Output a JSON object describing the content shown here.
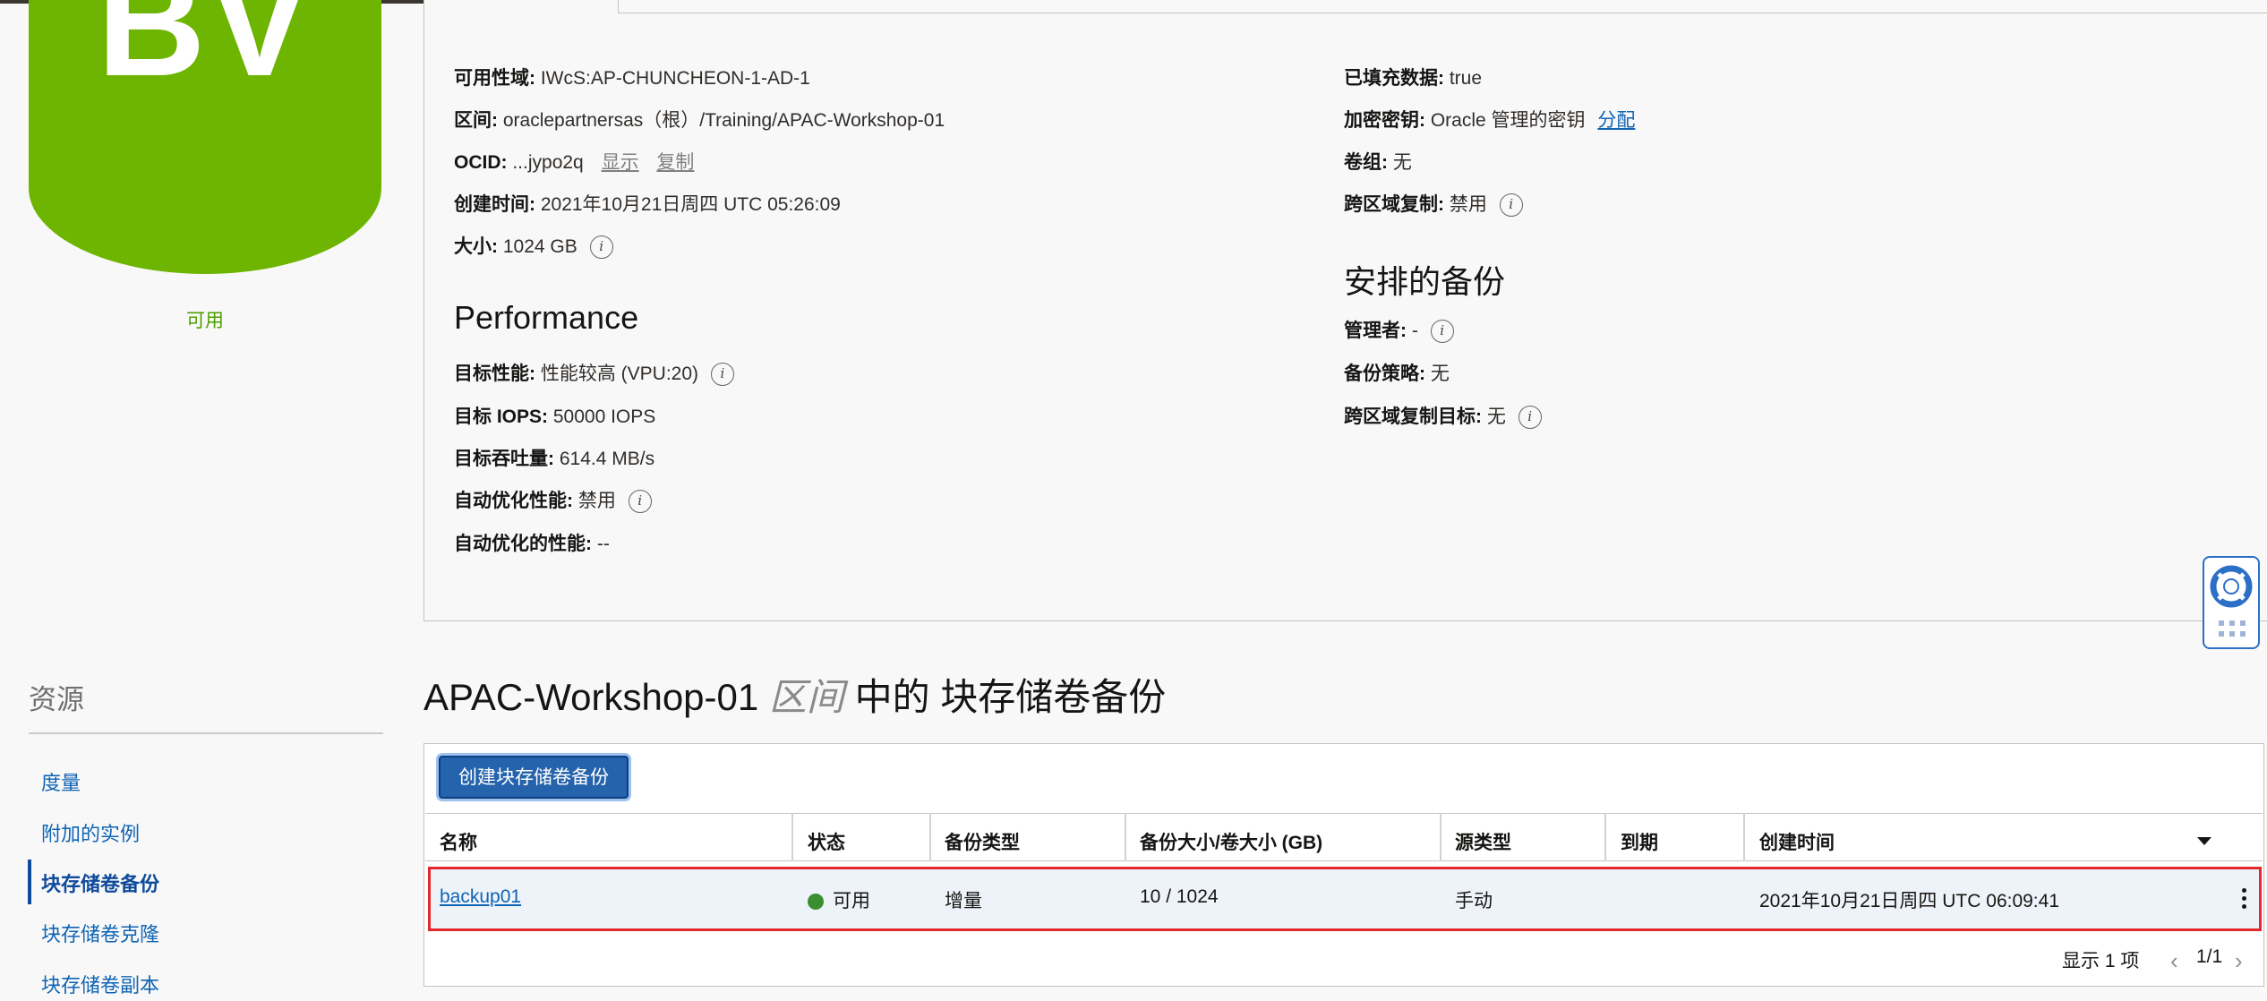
{
  "resource_icon": {
    "letters": "BV",
    "status": "可用",
    "color": "#6db500"
  },
  "resources": {
    "title": "资源",
    "items": [
      {
        "label": "度量",
        "active": false
      },
      {
        "label": "附加的实例",
        "active": false
      },
      {
        "label": "块存储卷备份",
        "active": true
      },
      {
        "label": "块存储卷克隆",
        "active": false
      },
      {
        "label": "块存储卷副本",
        "active": false
      }
    ]
  },
  "details": {
    "left": {
      "availability_domain": {
        "label": "可用性域:",
        "value": "IWcS:AP-CHUNCHEON-1-AD-1"
      },
      "compartment": {
        "label": "区间:",
        "value": "oraclepartnersas（根）/Training/APAC-Workshop-01"
      },
      "ocid": {
        "label": "OCID:",
        "value": "...jypo2q",
        "show": "显示",
        "copy": "复制"
      },
      "created": {
        "label": "创建时间:",
        "value": "2021年10月21日周四 UTC 05:26:09"
      },
      "size": {
        "label": "大小:",
        "value": "1024 GB"
      }
    },
    "performance": {
      "heading": "Performance",
      "target_performance": {
        "label": "目标性能:",
        "value": "性能较高 (VPU:20)"
      },
      "target_iops": {
        "label": "目标 IOPS:",
        "value": "50000 IOPS"
      },
      "target_throughput": {
        "label": "目标吞吐量:",
        "value": "614.4 MB/s"
      },
      "auto_tune": {
        "label": "自动优化性能:",
        "value": "禁用"
      },
      "auto_tuned": {
        "label": "自动优化的性能:",
        "value": "--"
      }
    },
    "right": {
      "hydrated": {
        "label": "已填充数据:",
        "value": "true"
      },
      "encryption": {
        "label": "加密密钥:",
        "value": "Oracle 管理的密钥",
        "link": "分配"
      },
      "volume_group": {
        "label": "卷组:",
        "value": "无"
      },
      "cross_region": {
        "label": "跨区域复制:",
        "value": "禁用"
      }
    },
    "scheduled_backups": {
      "heading": "安排的备份",
      "managed_by": {
        "label": "管理者:",
        "value": "-"
      },
      "policy": {
        "label": "备份策略:",
        "value": "无"
      },
      "cross_region_target": {
        "label": "跨区域复制目标:",
        "value": "无"
      }
    }
  },
  "backups": {
    "heading_prefix": "APAC-Workshop-01",
    "heading_keyword": "区间",
    "heading_suffix": "中的 块存储卷备份",
    "create_button": "创建块存储卷备份",
    "columns": [
      "名称",
      "状态",
      "备份类型",
      "备份大小/卷大小 (GB)",
      "源类型",
      "到期",
      "创建时间"
    ],
    "rows": [
      {
        "name": "backup01",
        "status": "可用",
        "status_color": "#3b8f2e",
        "type": "增量",
        "size": "10 / 1024",
        "source": "手动",
        "expiry": "",
        "created": "2021年10月21日周四 UTC 06:09:41"
      }
    ],
    "pager": {
      "summary": "显示 1 项",
      "pages": "1/1"
    }
  }
}
